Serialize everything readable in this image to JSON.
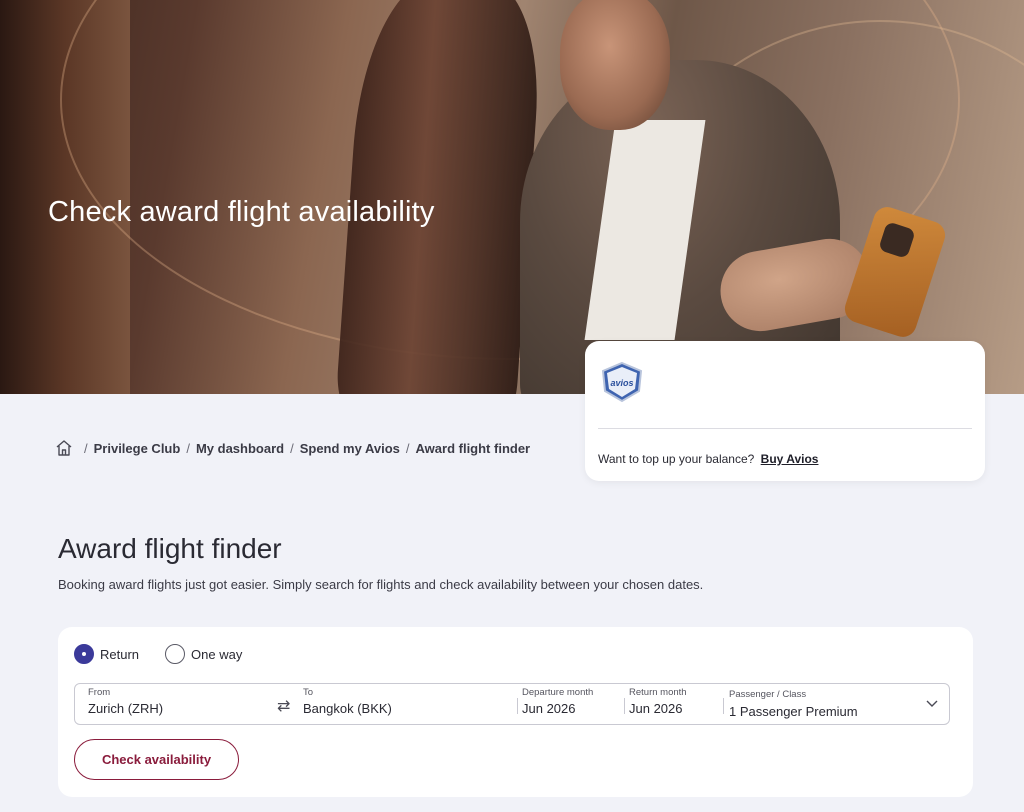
{
  "hero": {
    "title": "Check award flight availability"
  },
  "avios_card": {
    "logo_text": "avios",
    "topup_prompt": "Want to top up your balance?",
    "buy_link": "Buy Avios"
  },
  "breadcrumb": {
    "items": [
      {
        "label": "Privilege Club"
      },
      {
        "label": "My dashboard"
      },
      {
        "label": "Spend my Avios"
      },
      {
        "label": "Award flight finder"
      }
    ],
    "separator": "/"
  },
  "main": {
    "title": "Award flight finder",
    "description": "Booking award flights just got easier. Simply search for flights and check availability between your chosen dates."
  },
  "search": {
    "trip_types": [
      {
        "label": "Return",
        "selected": true
      },
      {
        "label": "One way",
        "selected": false
      }
    ],
    "from": {
      "label": "From",
      "value": "Zurich (ZRH)"
    },
    "to": {
      "label": "To",
      "value": "Bangkok (BKK)"
    },
    "departure": {
      "label": "Departure month",
      "value": "Jun 2026"
    },
    "return": {
      "label": "Return month",
      "value": "Jun 2026"
    },
    "passenger": {
      "label": "Passenger / Class",
      "value": "1 Passenger Premium"
    },
    "swap_icon": "⇄",
    "submit_label": "Check availability"
  },
  "colors": {
    "accent_purple": "#3b3a9a",
    "button_burgundy": "#8a1c3c",
    "page_bg": "#f1f2f8"
  }
}
